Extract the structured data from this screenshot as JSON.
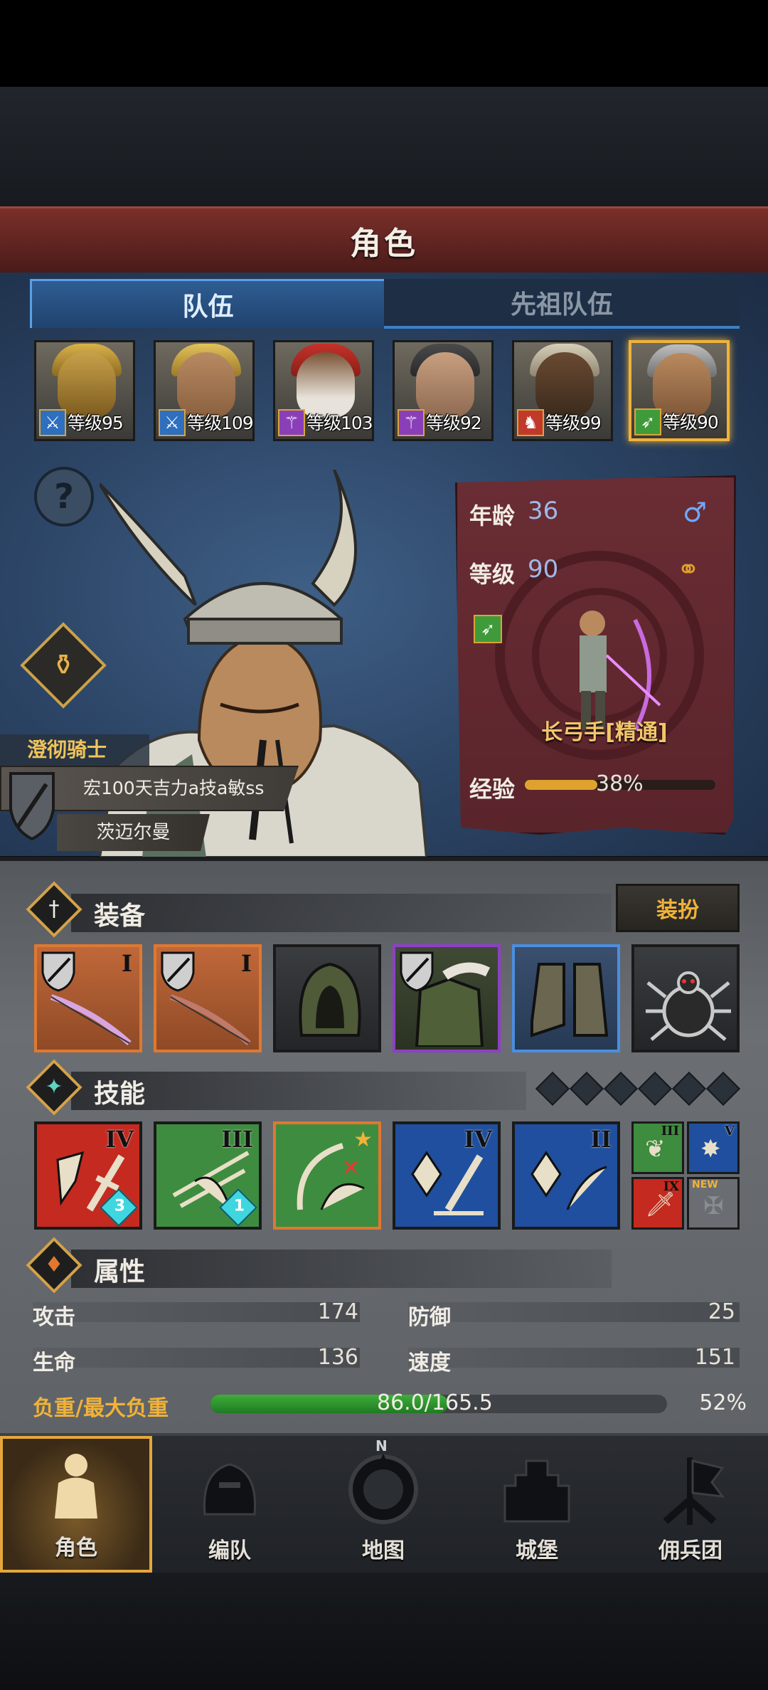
{
  "header": {
    "title": "角色"
  },
  "tabs": [
    {
      "label": "队伍",
      "active": true
    },
    {
      "label": "先祖队伍",
      "active": false
    }
  ],
  "roster": [
    {
      "level": "等级95",
      "class_color": "#2e6fbf",
      "selected": false,
      "class_icon": "sword-icon"
    },
    {
      "level": "等级109",
      "class_color": "#2e6fbf",
      "selected": false,
      "class_icon": "sword-icon"
    },
    {
      "level": "等级103",
      "class_color": "#8a3fb8",
      "selected": false,
      "class_icon": "staff-icon"
    },
    {
      "level": "等级92",
      "class_color": "#8a3fb8",
      "selected": false,
      "class_icon": "staff-icon"
    },
    {
      "level": "等级99",
      "class_color": "#c0392b",
      "selected": false,
      "class_icon": "horse-icon"
    },
    {
      "level": "等级90",
      "class_color": "#3f9b3a",
      "selected": true,
      "class_icon": "bow-icon"
    }
  ],
  "hero": {
    "title": "澄彻骑士",
    "nickname": "宏100天吉力a技a敏ss",
    "name": "茨迈尔曼"
  },
  "info": {
    "age_label": "年龄",
    "age": "36",
    "level_label": "等级",
    "level": "90",
    "class_name": "长弓手[精通]",
    "exp_label": "经验",
    "exp_percent": "38%",
    "exp_fraction": 0.38
  },
  "equipment": {
    "title": "装备",
    "dress_button": "装扮",
    "slots": [
      {
        "name": "bow",
        "rarity_color": "#e0782f",
        "tier": "I"
      },
      {
        "name": "bow",
        "rarity_color": "#e0782f",
        "tier": "I"
      },
      {
        "name": "hood",
        "rarity_color": "#1a1a1a",
        "tier": ""
      },
      {
        "name": "armor",
        "rarity_color": "#8e3fc6",
        "tier": ""
      },
      {
        "name": "boots",
        "rarity_color": "#4a8ee0",
        "tier": ""
      },
      {
        "name": "amulet",
        "rarity_color": "#1a1a1a",
        "tier": ""
      }
    ]
  },
  "skills": {
    "title": "技能",
    "slots": [
      {
        "bg": "#c42a1f",
        "tier": "IV",
        "count": "3"
      },
      {
        "bg": "#3e8c3f",
        "tier": "III",
        "count": "1"
      },
      {
        "bg": "#3e8c3f",
        "tier": "",
        "count": ""
      },
      {
        "bg": "#1f4f9e",
        "tier": "IV",
        "count": ""
      },
      {
        "bg": "#1f4f9e",
        "tier": "II",
        "count": ""
      }
    ],
    "mini": [
      {
        "bg": "#3e8c3f",
        "tier": "III"
      },
      {
        "bg": "#1f4f9e",
        "tier": "V"
      },
      {
        "bg": "#c42a1f",
        "tier": "IX"
      },
      {
        "bg": "#6a6e72",
        "tier": "",
        "badge": "NEW"
      }
    ]
  },
  "attributes": {
    "title": "属性",
    "attack_label": "攻击",
    "attack": "174",
    "defense_label": "防御",
    "defense": "25",
    "hp_label": "生命",
    "hp": "136",
    "speed_label": "速度",
    "speed": "151",
    "load_label": "负重/最大负重",
    "load_value": "86.0/165.5",
    "load_percent": "52%",
    "load_fraction": 0.52
  },
  "nav": [
    {
      "label": "角色",
      "active": true
    },
    {
      "label": "编队",
      "active": false
    },
    {
      "label": "地图",
      "active": false
    },
    {
      "label": "城堡",
      "active": false
    },
    {
      "label": "佣兵团",
      "active": false
    }
  ],
  "compass_letter": "N"
}
